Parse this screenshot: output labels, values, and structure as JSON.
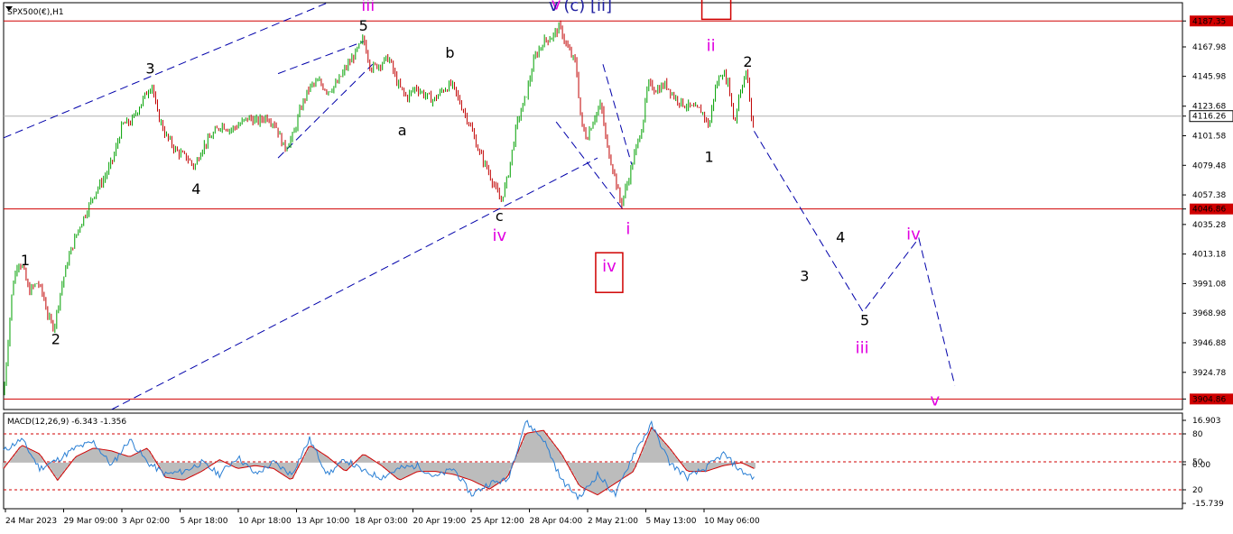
{
  "symbol_label": "SPX500(€),H1",
  "macd_label": "MACD(12,26,9) -6.343 -1.356",
  "top_header_text": "v  (c) [ii]",
  "colors": {
    "background": "#ffffff",
    "up_candle": "#00a000",
    "down_candle": "#c00000",
    "level_line": "#d00000",
    "channel": "#0000aa",
    "wave_black": "#000000",
    "wave_magenta": "#e100e1",
    "macd_fill": "#bcbcbc",
    "macd_signal": "#d00000",
    "macd_main": "#2a7fd4"
  },
  "chart_data": [
    {
      "type": "candlestick",
      "title": "SPX500(€),H1",
      "y_ticks": [
        "4187.35",
        "4167.98",
        "4145.98",
        "4123.68",
        "4116.26",
        "4101.58",
        "4079.48",
        "4057.38",
        "4046.86",
        "4035.28",
        "4013.18",
        "3991.08",
        "3968.98",
        "3946.88",
        "3924.78",
        "3904.86"
      ],
      "highlighted_levels": [
        4187.35,
        4046.86,
        3904.86
      ],
      "current_price": 4116.26,
      "ylim": [
        3897,
        4201
      ],
      "x_ticks": [
        "24 Mar 2023",
        "29 Mar 09:00",
        "3 Apr 02:00",
        "5 Apr 18:00",
        "10 Apr 18:00",
        "13 Apr 10:00",
        "18 Apr 03:00",
        "20 Apr 19:00",
        "25 Apr 12:00",
        "28 Apr 04:00",
        "2 May 21:00",
        "5 May 13:00",
        "10 May 06:00"
      ],
      "x_range": [
        0,
        1310
      ],
      "price_path": [
        [
          0,
          3908
        ],
        [
          10,
          3990
        ],
        [
          16,
          4008
        ],
        [
          22,
          4002
        ],
        [
          28,
          3985
        ],
        [
          38,
          3992
        ],
        [
          44,
          3982
        ],
        [
          50,
          3965
        ],
        [
          56,
          3958
        ],
        [
          64,
          3988
        ],
        [
          72,
          4010
        ],
        [
          82,
          4030
        ],
        [
          92,
          4045
        ],
        [
          102,
          4060
        ],
        [
          112,
          4070
        ],
        [
          122,
          4085
        ],
        [
          132,
          4110
        ],
        [
          142,
          4112
        ],
        [
          152,
          4125
        ],
        [
          160,
          4135
        ],
        [
          165,
          4140
        ],
        [
          170,
          4120
        ],
        [
          180,
          4102
        ],
        [
          192,
          4090
        ],
        [
          204,
          4085
        ],
        [
          212,
          4078
        ],
        [
          220,
          4092
        ],
        [
          232,
          4102
        ],
        [
          242,
          4110
        ],
        [
          252,
          4106
        ],
        [
          262,
          4110
        ],
        [
          272,
          4115
        ],
        [
          282,
          4112
        ],
        [
          292,
          4116
        ],
        [
          302,
          4110
        ],
        [
          312,
          4092
        ],
        [
          322,
          4102
        ],
        [
          330,
          4122
        ],
        [
          340,
          4138
        ],
        [
          350,
          4142
        ],
        [
          360,
          4135
        ],
        [
          370,
          4140
        ],
        [
          380,
          4152
        ],
        [
          390,
          4162
        ],
        [
          400,
          4174
        ],
        [
          408,
          4152
        ],
        [
          418,
          4155
        ],
        [
          428,
          4160
        ],
        [
          438,
          4140
        ],
        [
          448,
          4130
        ],
        [
          458,
          4138
        ],
        [
          468,
          4132
        ],
        [
          478,
          4128
        ],
        [
          488,
          4136
        ],
        [
          498,
          4140
        ],
        [
          508,
          4125
        ],
        [
          518,
          4110
        ],
        [
          528,
          4090
        ],
        [
          538,
          4076
        ],
        [
          548,
          4060
        ],
        [
          552,
          4052
        ],
        [
          560,
          4070
        ],
        [
          570,
          4110
        ],
        [
          580,
          4130
        ],
        [
          590,
          4160
        ],
        [
          600,
          4172
        ],
        [
          610,
          4176
        ],
        [
          618,
          4183
        ],
        [
          626,
          4168
        ],
        [
          636,
          4155
        ],
        [
          642,
          4110
        ],
        [
          648,
          4100
        ],
        [
          656,
          4115
        ],
        [
          664,
          4125
        ],
        [
          670,
          4095
        ],
        [
          678,
          4075
        ],
        [
          686,
          4050
        ],
        [
          694,
          4068
        ],
        [
          702,
          4090
        ],
        [
          710,
          4110
        ],
        [
          716,
          4140
        ],
        [
          726,
          4136
        ],
        [
          736,
          4140
        ],
        [
          746,
          4130
        ],
        [
          756,
          4125
        ],
        [
          766,
          4122
        ],
        [
          776,
          4120
        ],
        [
          784,
          4108
        ],
        [
          790,
          4135
        ],
        [
          798,
          4150
        ],
        [
          806,
          4140
        ],
        [
          812,
          4110
        ],
        [
          818,
          4135
        ],
        [
          826,
          4150
        ],
        [
          830,
          4120
        ],
        [
          834,
          4105
        ]
      ],
      "projection_path": [
        [
          834,
          4105
        ],
        [
          955,
          3970
        ],
        [
          1017,
          4025
        ],
        [
          1057,
          3915
        ]
      ],
      "channel_lines": [
        {
          "from": [
            0,
            4100
          ],
          "to": [
            360,
            4201
          ]
        },
        {
          "from": [
            305,
            4085
          ],
          "to": [
            410,
            4155
          ]
        },
        {
          "from": [
            305,
            4148
          ],
          "to": [
            400,
            4172
          ]
        },
        {
          "from": [
            120,
            3897
          ],
          "to": [
            660,
            4085
          ]
        },
        {
          "from": [
            614,
            4112
          ],
          "to": [
            690,
            4045
          ]
        },
        {
          "from": [
            666,
            4155
          ],
          "to": [
            698,
            4080
          ]
        }
      ],
      "wave_labels": [
        {
          "text": "1",
          "x": 24,
          "y": 4005,
          "color": "black"
        },
        {
          "text": "2",
          "x": 58,
          "y": 3946,
          "color": "black"
        },
        {
          "text": "3",
          "x": 163,
          "y": 4148,
          "color": "black"
        },
        {
          "text": "4",
          "x": 214,
          "y": 4058,
          "color": "black"
        },
        {
          "text": "5",
          "x": 400,
          "y": 4180,
          "color": "black"
        },
        {
          "text": "iii",
          "x": 405,
          "y": 4195,
          "color": "magenta"
        },
        {
          "text": "a",
          "x": 443,
          "y": 4102,
          "color": "black"
        },
        {
          "text": "b",
          "x": 496,
          "y": 4160,
          "color": "black"
        },
        {
          "text": "c",
          "x": 551,
          "y": 4038,
          "color": "black"
        },
        {
          "text": "iv",
          "x": 551,
          "y": 4023,
          "color": "magenta"
        },
        {
          "text": "v",
          "x": 614,
          "y": 4196,
          "color": "magenta"
        },
        {
          "text": "i",
          "x": 694,
          "y": 4028,
          "color": "magenta"
        },
        {
          "text": "iv",
          "x": 673,
          "y": 4000,
          "color": "magenta",
          "boxed": true
        },
        {
          "text": "ii",
          "x": 786,
          "y": 4165,
          "color": "magenta"
        },
        {
          "text": "2",
          "x": 827,
          "y": 4153,
          "color": "black"
        },
        {
          "text": "1",
          "x": 784,
          "y": 4082,
          "color": "black"
        },
        {
          "text": "4",
          "x": 930,
          "y": 4022,
          "color": "black"
        },
        {
          "text": "iv",
          "x": 1011,
          "y": 4024,
          "color": "magenta"
        },
        {
          "text": "3",
          "x": 890,
          "y": 3993,
          "color": "black"
        },
        {
          "text": "5",
          "x": 957,
          "y": 3960,
          "color": "black"
        },
        {
          "text": "iii",
          "x": 954,
          "y": 3939,
          "color": "magenta"
        },
        {
          "text": "v",
          "x": 1035,
          "y": 3900,
          "color": "magenta"
        }
      ],
      "boxed_marks": [
        {
          "x": 792,
          "y": 4194
        }
      ]
    },
    {
      "type": "line",
      "title": "MACD(12,26,9) -6.343 -1.356",
      "y_ticks": [
        "16.903",
        "80",
        "50",
        "0.00",
        "20",
        "-15.739"
      ],
      "levels": [
        80,
        50,
        20
      ],
      "ylim": [
        -15.739,
        16.903
      ],
      "series": [
        {
          "values": [
            [
              0,
              -2
            ],
            [
              20,
              6
            ],
            [
              40,
              3
            ],
            [
              60,
              -6
            ],
            [
              80,
              2
            ],
            [
              100,
              5
            ],
            [
              120,
              4
            ],
            [
              140,
              2
            ],
            [
              160,
              5
            ],
            [
              180,
              -5
            ],
            [
              200,
              -6
            ],
            [
              220,
              -3
            ],
            [
              240,
              1
            ],
            [
              260,
              -2
            ],
            [
              280,
              -1
            ],
            [
              300,
              -2
            ],
            [
              320,
              -6
            ],
            [
              340,
              6
            ],
            [
              360,
              2
            ],
            [
              380,
              -3
            ],
            [
              400,
              3
            ],
            [
              420,
              -1
            ],
            [
              440,
              -6
            ],
            [
              460,
              -3
            ],
            [
              480,
              -3
            ],
            [
              500,
              -4
            ],
            [
              520,
              -6
            ],
            [
              540,
              -9
            ],
            [
              560,
              -5
            ],
            [
              580,
              10
            ],
            [
              600,
              11
            ],
            [
              620,
              3
            ],
            [
              640,
              -8
            ],
            [
              660,
              -11
            ],
            [
              680,
              -7
            ],
            [
              700,
              -3
            ],
            [
              720,
              12
            ],
            [
              740,
              5
            ],
            [
              760,
              -3
            ],
            [
              780,
              -3
            ],
            [
              800,
              -1
            ],
            [
              820,
              0
            ],
            [
              834,
              -2
            ]
          ]
        },
        {
          "values": [
            [
              0,
              4
            ],
            [
              20,
              8
            ],
            [
              40,
              -2
            ],
            [
              60,
              1
            ],
            [
              80,
              5
            ],
            [
              100,
              7
            ],
            [
              120,
              -1
            ],
            [
              140,
              8
            ],
            [
              160,
              0
            ],
            [
              180,
              -4
            ],
            [
              200,
              -3
            ],
            [
              220,
              0
            ],
            [
              240,
              -4
            ],
            [
              260,
              2
            ],
            [
              280,
              -4
            ],
            [
              300,
              0
            ],
            [
              320,
              -4
            ],
            [
              340,
              8
            ],
            [
              360,
              -4
            ],
            [
              380,
              1
            ],
            [
              400,
              -3
            ],
            [
              420,
              -5
            ],
            [
              440,
              -2
            ],
            [
              460,
              -1
            ],
            [
              480,
              -5
            ],
            [
              500,
              -2
            ],
            [
              520,
              -11
            ],
            [
              540,
              -7
            ],
            [
              560,
              -6
            ],
            [
              580,
              14
            ],
            [
              600,
              8
            ],
            [
              620,
              -6
            ],
            [
              640,
              -12
            ],
            [
              660,
              -4
            ],
            [
              680,
              -11
            ],
            [
              700,
              3
            ],
            [
              720,
              13
            ],
            [
              740,
              0
            ],
            [
              760,
              -5
            ],
            [
              780,
              -2
            ],
            [
              800,
              3
            ],
            [
              820,
              -3
            ],
            [
              834,
              -5
            ]
          ]
        }
      ]
    }
  ]
}
